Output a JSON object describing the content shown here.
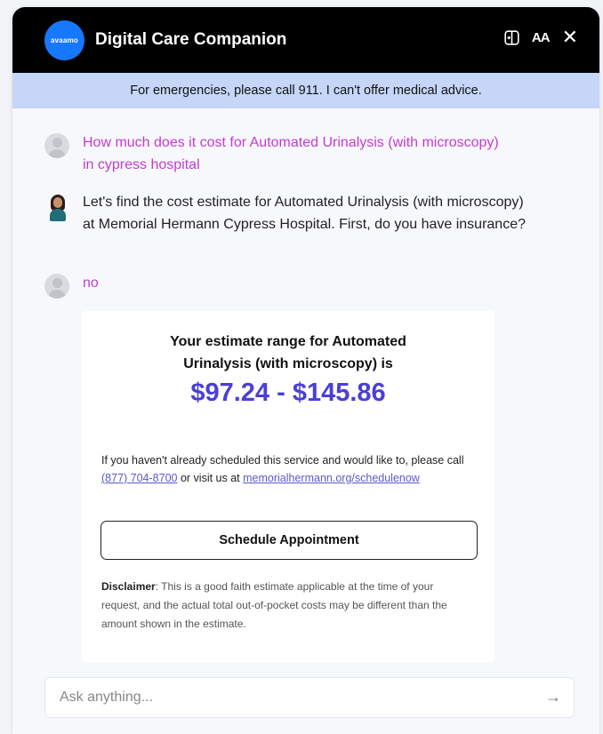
{
  "header": {
    "logo_text": "avaamo",
    "title": "Digital Care Companion",
    "expand_icon": "expand-panel-icon",
    "font_size_label": "AA",
    "close_label": "✕"
  },
  "notice": {
    "text": "For emergencies, please call 911. I can't offer medical advice."
  },
  "messages": [
    {
      "sender": "user",
      "text": "How much does it cost for Automated Urinalysis (with microscopy) in cypress hospital"
    },
    {
      "sender": "agent",
      "text": "Let's find the cost estimate for Automated Urinalysis (with microscopy) at Memorial Hermann Cypress Hospital. First, do you have insurance?"
    },
    {
      "sender": "user",
      "text": "no"
    }
  ],
  "estimate_card": {
    "heading_line1": "Your estimate range for Automated",
    "heading_line2": "Urinalysis (with microscopy) is",
    "price_range": "$97.24 - $145.86",
    "info_prefix": "If you haven't already scheduled this service and would like to, please call ",
    "phone": "(877) 704-8700",
    "info_middle": " or visit us at ",
    "url": "memorialhermann.org/schedulenow",
    "button_label": "Schedule Appointment",
    "disclaimer_label": "Disclaimer",
    "disclaimer_text": ": This is a good faith estimate applicable at the time of your request, and the actual total out-of-pocket costs may be different than the amount shown in the estimate."
  },
  "composer": {
    "placeholder": "Ask anything...",
    "send_icon": "→"
  },
  "colors": {
    "header_bg": "#000000",
    "notice_bg": "#c5d6f8",
    "user_text": "#c43bd2",
    "price": "#4a3fd6",
    "logo_bg": "#1677ff"
  }
}
